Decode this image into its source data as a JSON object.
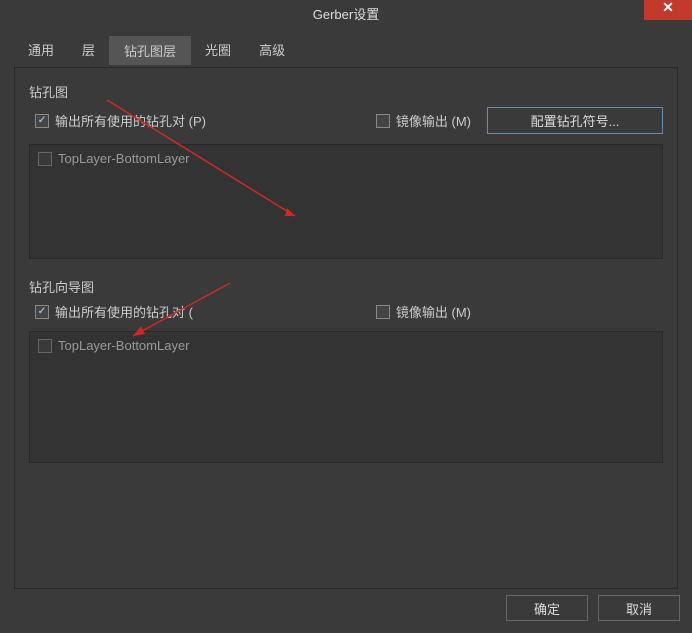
{
  "title": "Gerber设置",
  "close_symbol": "✕",
  "tabs": {
    "general": "通用",
    "layers": "层",
    "drill_layer": "钻孔图层",
    "aperture": "光圈",
    "advanced": "高级"
  },
  "drill_plot": {
    "group_label": "钻孔图",
    "output_all_label": "输出所有使用的钻孔对 (P)",
    "mirror_label": "镜像输出 (M)",
    "config_button": "配置钻孔符号...",
    "list_item": "TopLayer-BottomLayer"
  },
  "drill_guide": {
    "group_label": "钻孔向导图",
    "output_all_label": "输出所有使用的钻孔对 (",
    "mirror_label": "镜像输出 (M)",
    "list_item": "TopLayer-BottomLayer"
  },
  "buttons": {
    "ok": "确定",
    "cancel": "取消"
  }
}
